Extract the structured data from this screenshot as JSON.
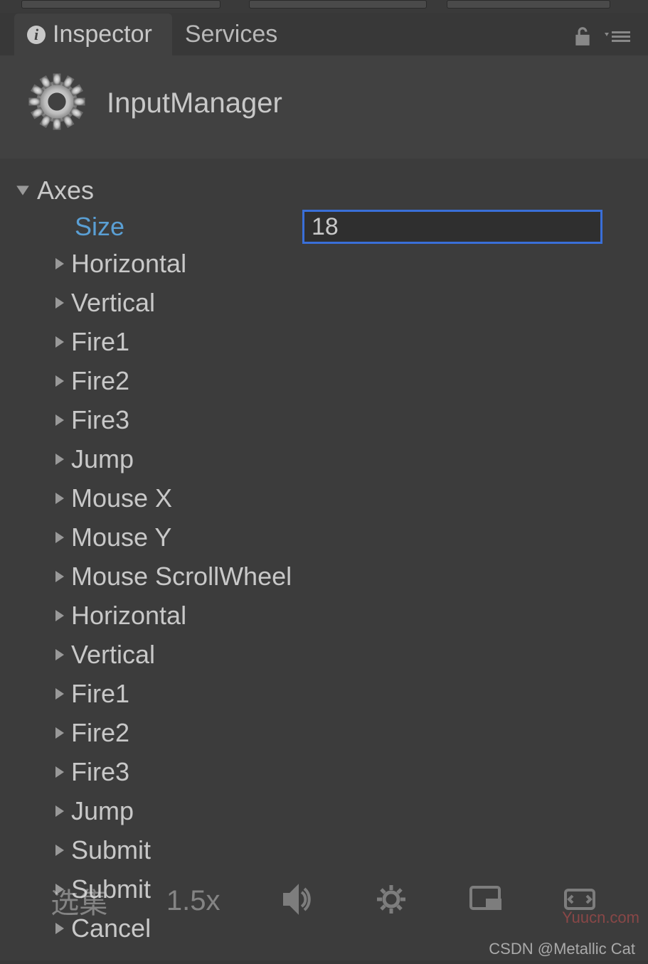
{
  "tabs": {
    "inspector": "Inspector",
    "services": "Services"
  },
  "header": {
    "title": "InputManager"
  },
  "axes": {
    "label": "Axes",
    "size_label": "Size",
    "size_value": "18",
    "items": [
      "Horizontal",
      "Vertical",
      "Fire1",
      "Fire2",
      "Fire3",
      "Jump",
      "Mouse X",
      "Mouse Y",
      "Mouse ScrollWheel",
      "Horizontal",
      "Vertical",
      "Fire1",
      "Fire2",
      "Fire3",
      "Jump",
      "Submit",
      "Submit",
      "Cancel"
    ]
  },
  "video_overlay": {
    "left_text": "选集",
    "speed": "1.5x"
  },
  "watermarks": {
    "top": "Yuucn.com",
    "bottom": "CSDN @Metallic Cat"
  }
}
